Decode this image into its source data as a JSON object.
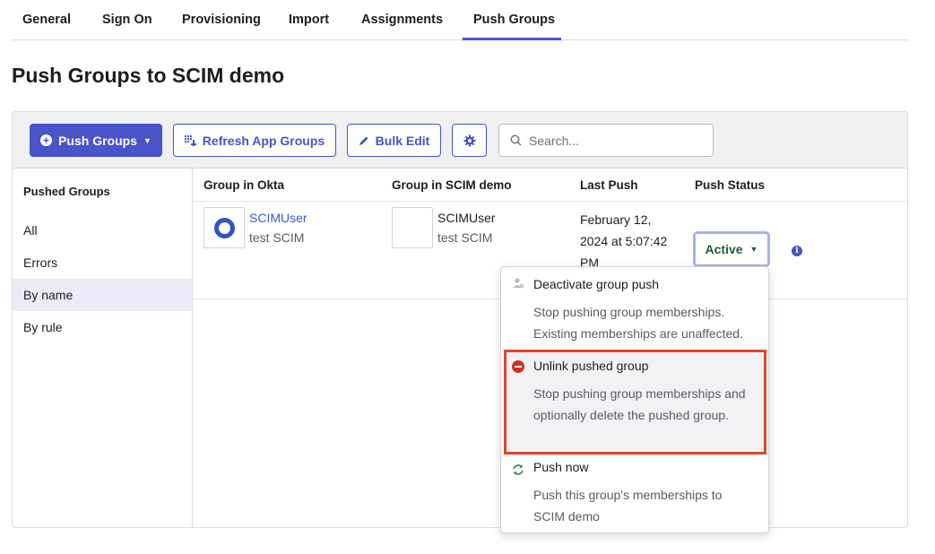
{
  "tabs": [
    {
      "label": "General"
    },
    {
      "label": "Sign On"
    },
    {
      "label": "Provisioning"
    },
    {
      "label": "Import"
    },
    {
      "label": "Assignments"
    },
    {
      "label": "Push Groups"
    }
  ],
  "active_tab": "Push Groups",
  "page_title": "Push Groups to SCIM demo",
  "toolbar": {
    "push_groups_label": "Push Groups",
    "refresh_label": "Refresh App Groups",
    "bulk_edit_label": "Bulk Edit",
    "search_placeholder": "Search..."
  },
  "sidenav": {
    "title": "Pushed Groups",
    "items": [
      {
        "label": "All"
      },
      {
        "label": "Errors"
      },
      {
        "label": "By name"
      },
      {
        "label": "By rule"
      }
    ],
    "selected": "By name"
  },
  "table": {
    "headers": [
      "Group in Okta",
      "Group in SCIM demo",
      "Last Push",
      "Push Status"
    ],
    "rows": [
      {
        "okta_group": "SCIMUser",
        "okta_group_desc": "test SCIM",
        "app_group": "SCIMUser",
        "app_group_desc": "test SCIM",
        "last_push": "February 12, 2024 at 5:07:42 PM",
        "status": "Active"
      }
    ]
  },
  "status_menu": {
    "items": [
      {
        "title": "Deactivate group push",
        "description": "Stop pushing group memberships. Existing memberships are unaffected."
      },
      {
        "title": "Unlink pushed group",
        "description": "Stop pushing group memberships and optionally delete the pushed group."
      },
      {
        "title": "Push now",
        "description": "Push this group's memberships to SCIM demo"
      }
    ]
  },
  "colors": {
    "accent": "#4854c7",
    "status_active": "#1b5e35",
    "highlight_border": "#e2452b",
    "unlink_icon": "#d1311e"
  }
}
